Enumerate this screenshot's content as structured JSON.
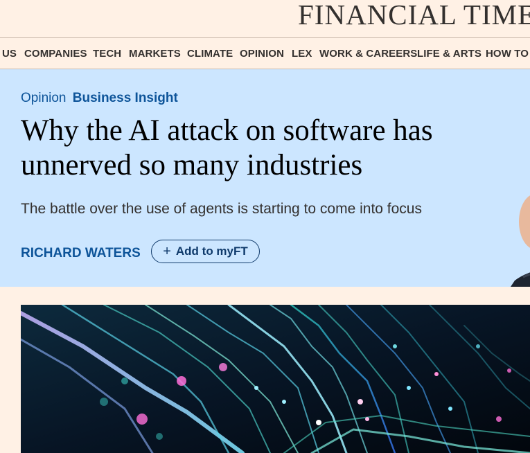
{
  "masthead": {
    "title": "FINANCIAL TIMES"
  },
  "nav": {
    "items": [
      "US",
      "COMPANIES",
      "TECH",
      "MARKETS",
      "CLIMATE",
      "OPINION",
      "LEX",
      "WORK & CAREERS",
      "LIFE & ARTS",
      "HOW TO SPEND IT"
    ]
  },
  "article": {
    "kicker_tag": "Opinion",
    "kicker_series": "Business Insight",
    "headline": "Why the AI attack on software has unnerved so many industries",
    "standfirst": "The battle over the use of agents is starting to come into focus",
    "author": "RICHARD WATERS",
    "myft_label": "Add to myFT"
  },
  "colors": {
    "page_bg": "#fff1e5",
    "hero_bg": "#cce6ff",
    "link_blue": "#0d5499",
    "text_dark": "#33302e"
  }
}
